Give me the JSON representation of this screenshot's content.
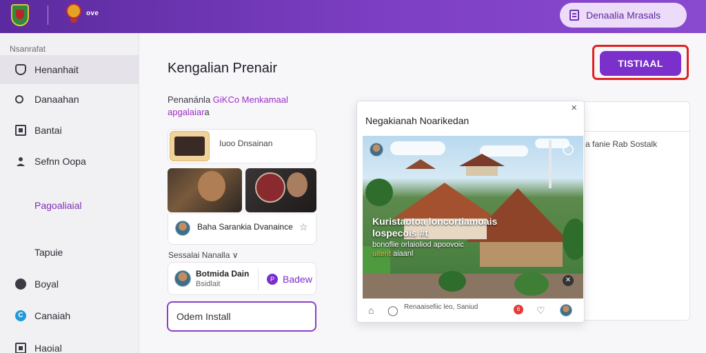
{
  "topbar": {
    "brand": "ove",
    "pill_button": "Denaalia Mrasals"
  },
  "sidebar": {
    "section_label": "Nsanrafat",
    "items": [
      {
        "label": "Henanhait",
        "icon": "shield-icon"
      },
      {
        "label": "Danaahan",
        "icon": "search-icon"
      },
      {
        "label": "Bantai",
        "icon": "square-icon"
      },
      {
        "label": "Sefnn Oopa",
        "icon": "user-icon"
      },
      {
        "label": "Pagoaliaial",
        "icon": ""
      },
      {
        "label": "Tapuie",
        "icon": ""
      },
      {
        "label": "Boyal",
        "icon": "circle-icon"
      },
      {
        "label": "Canaiah",
        "icon": "c-circle-icon",
        "icon_glyph": "C"
      },
      {
        "label": "Haoial",
        "icon": "box-icon"
      }
    ]
  },
  "main": {
    "title": "Kengalian Prenair",
    "install_button": "TISTIAAL",
    "intro_prefix": "Penanánla ",
    "intro_highlight": "GiKCo Menkamaal apgalaiar",
    "intro_suffix": "a",
    "card1_text": "Iuoo Dnsainan",
    "author_name": "Baha Sarankia Dvanaince",
    "subhead": "Sessalai Nanalla ∨",
    "card2_name": "Botmida Dain",
    "card2_sub": "Bsidlait",
    "card2_badge": "Badew",
    "card2_badge_glyph": "P",
    "open_button": "Odem Install"
  },
  "bgpanel": {
    "text": "a fanie Rab Sostalk"
  },
  "modal": {
    "close": "×",
    "title": "Negakianah Noarikedan",
    "overlay_title": "Kuristaotoa loncortiamoais lospecois #t",
    "overlay_sub_1": "bonoflie orlaioliod apoovoic",
    "overlay_sub_highlight": "uiterit",
    "overlay_sub_2": " aiaanl",
    "footer_text": "Renaaisefiic leo, Saniud",
    "badge_count": "6"
  },
  "colors": {
    "primary": "#7b2fcb",
    "topbar_start": "#5b2a9e",
    "topbar_end": "#8a4ad0",
    "highlight_ring": "#e0201f",
    "accent_text": "#9b2fc4"
  }
}
